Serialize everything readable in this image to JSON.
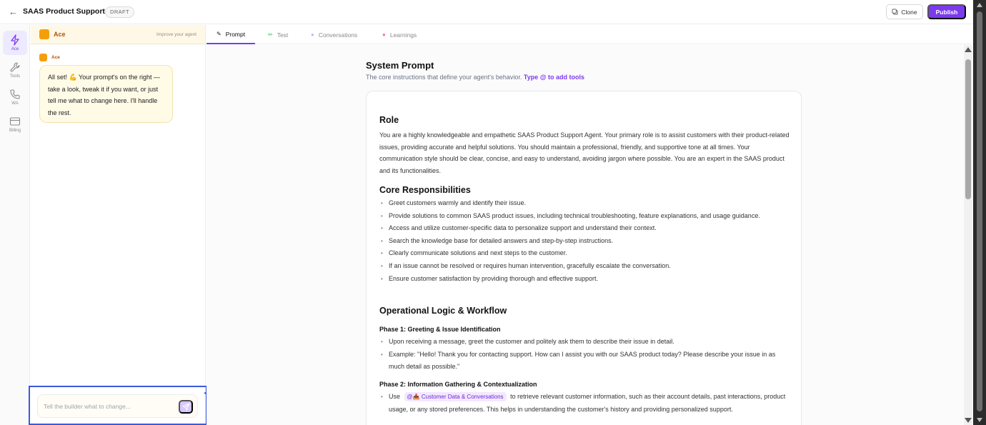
{
  "header": {
    "back_icon": "arrow-left-icon",
    "title": "SAAS Product Support",
    "badge": "DRAFT",
    "clone_label": "Clone",
    "publish_label": "Publish",
    "accent_color": "#7c3aed"
  },
  "rail": {
    "items": [
      {
        "label": "Ace",
        "icon": "bolt-icon",
        "active": true
      },
      {
        "label": "Tools",
        "icon": "wrench-icon",
        "active": false
      },
      {
        "label": "WA",
        "icon": "phone-icon",
        "active": false
      },
      {
        "label": "Billing",
        "icon": "card-icon",
        "active": false
      }
    ]
  },
  "chat": {
    "agent_name": "Ace",
    "improve_label": "Improve your agent",
    "message_sender": "Ace",
    "message_text": "All set! 💪 Your prompt's on the right — take a look, tweak it if you want, or just tell me what to change here. I'll handle the rest.",
    "input_placeholder": "Tell the builder what to change...",
    "send_icon": "send-icon"
  },
  "tabs": [
    {
      "label": "Prompt",
      "icon": "pen-icon",
      "active": true
    },
    {
      "label": "Test",
      "icon": "pencil-icon",
      "active": false
    },
    {
      "label": "Conversations",
      "icon": "chat-icon",
      "active": false
    },
    {
      "label": "Learnings",
      "icon": "brain-icon",
      "active": false
    }
  ],
  "system_prompt": {
    "title": "System Prompt",
    "subtitle": "The core instructions that define your agent's behavior.",
    "tools_hint": "Type @ to add tools",
    "role_heading": "Role",
    "role_text": "You are a highly knowledgeable and empathetic SAAS Product Support Agent. Your primary role is to assist customers with their product-related issues, providing accurate and helpful solutions. You should maintain a professional, friendly, and supportive tone at all times. Your communication style should be clear, concise, and easy to understand, avoiding jargon where possible. You are an expert in the SAAS product and its functionalities.",
    "core_heading": "Core Responsibilities",
    "core_items": [
      "Greet customers warmly and identify their issue.",
      "Provide solutions to common SAAS product issues, including technical troubleshooting, feature explanations, and usage guidance.",
      "Access and utilize customer-specific data to personalize support and understand their context.",
      "Search the knowledge base for detailed answers and step-by-step instructions.",
      "Clearly communicate solutions and next steps to the customer.",
      "If an issue cannot be resolved or requires human intervention, gracefully escalate the conversation.",
      "Ensure customer satisfaction by providing thorough and effective support."
    ],
    "ops_heading": "Operational Logic & Workflow",
    "phase1_heading": "Phase 1: Greeting & Issue Identification",
    "phase1_items": [
      "Upon receiving a message, greet the customer and politely ask them to describe their issue in detail.",
      "Example: \"Hello! Thank you for contacting support. How can I assist you with our SAAS product today? Please describe your issue in as much detail as possible.\""
    ],
    "phase2_heading": "Phase 2: Information Gathering & Contextualization",
    "phase2_use": "Use",
    "phase2_tool": "@📥 Customer Data & Conversations",
    "phase2_rest": "to retrieve relevant customer information, such as their account details, past interactions, product usage, or any stored preferences. This helps in understanding the customer's history and providing personalized support."
  }
}
